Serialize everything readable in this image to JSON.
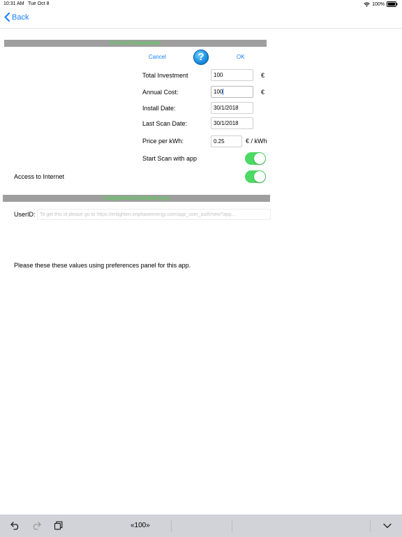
{
  "status": {
    "time": "10:31 AM",
    "date": "Tue Oct 8",
    "battery": "100%"
  },
  "nav": {
    "back_label": "Back"
  },
  "section1": {
    "title": "First Init Parameters"
  },
  "actions": {
    "cancel": "Cancel",
    "help": "?",
    "ok": "OK"
  },
  "form": {
    "total_investment": {
      "label": "Total Investment",
      "value": "100",
      "unit": "€"
    },
    "annual_cost": {
      "label": "Annual Cost:",
      "value": "100",
      "unit": "€"
    },
    "install_date": {
      "label": "Install Date:",
      "value": "30/1/2018"
    },
    "last_scan_date": {
      "label": "Last Scan Date:",
      "value": "30/1/2018"
    },
    "price_kwh": {
      "label": "Price per kWh:",
      "value": "0.25",
      "unit": "€ / kWh"
    },
    "start_scan": {
      "label": "Start Scan with app",
      "on": true
    },
    "access_internet": {
      "label": "Access to Internet",
      "on": true
    }
  },
  "section2": {
    "title": "Enlightened Enphase keys"
  },
  "userid": {
    "label": "UserID:",
    "placeholder": "To get this id please go to https://enlighten.enphaseenergy.com/app_user_auth/new?app..."
  },
  "note": "Please these these values using preferences panel for this app.",
  "keyboard_bar": {
    "suggestion": "«100»"
  },
  "colors": {
    "accent": "#157efb",
    "toggle_on": "#4cd964",
    "section_text": "#44dd44",
    "section_bg": "#9e9e9e"
  }
}
